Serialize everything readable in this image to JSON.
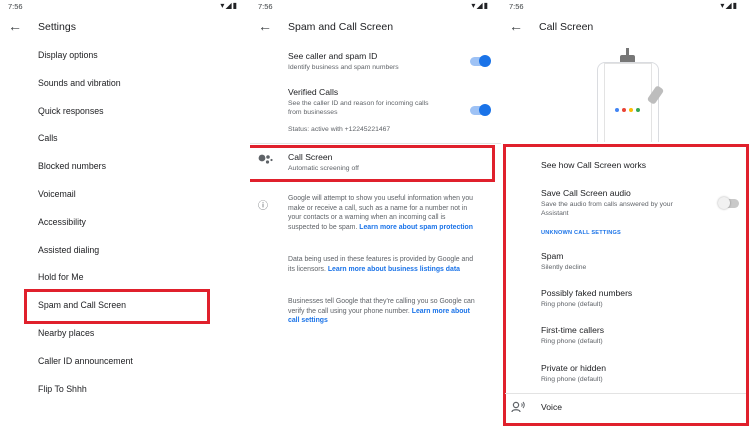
{
  "status": {
    "time": "7:56",
    "icons": "▾◢▮"
  },
  "settings": {
    "title": "Settings",
    "items": [
      "Display options",
      "Sounds and vibration",
      "Quick responses",
      "Calls",
      "Blocked numbers",
      "Voicemail",
      "Accessibility",
      "Assisted dialing",
      "Hold for Me",
      "Spam and Call Screen",
      "Nearby places",
      "Caller ID announcement",
      "Flip To Shhh"
    ]
  },
  "spam": {
    "title": "Spam and Call Screen",
    "caller_id": {
      "label": "See caller and spam ID",
      "sub": "Identify business and spam numbers",
      "on": true
    },
    "verified": {
      "label": "Verified Calls",
      "sub": "See the caller ID and reason for incoming calls from businesses",
      "on": true
    },
    "status_text": "Status: active with +12245221467",
    "call_screen": {
      "label": "Call Screen",
      "sub": "Automatic screening off"
    },
    "info1": {
      "text": "Google will attempt to show you useful information when you make or receive a call, such as a name for a number not in your contacts or a warning when an incoming call is suspected to be spam.",
      "link": "Learn more about spam protection"
    },
    "info2": {
      "text": "Data being used in these features is provided by Google and its licensors.",
      "link": "Learn more about business listings data"
    },
    "info3": {
      "text": "Businesses tell Google that they're calling you so Google can verify the call using your phone number.",
      "link": "Learn more about call settings"
    }
  },
  "callscreen": {
    "title": "Call Screen",
    "how_link": "See how Call Screen works",
    "save_audio": {
      "label": "Save Call Screen audio",
      "sub": "Save the audio from calls answered by your Assistant",
      "on": false
    },
    "section_header": "UNKNOWN CALL SETTINGS",
    "options": [
      {
        "label": "Spam",
        "value": "Silently decline"
      },
      {
        "label": "Possibly faked numbers",
        "value": "Ring phone (default)"
      },
      {
        "label": "First-time callers",
        "value": "Ring phone (default)"
      },
      {
        "label": "Private or hidden",
        "value": "Ring phone (default)"
      }
    ],
    "voice": "Voice"
  },
  "colors": {
    "highlight": "#e0202c",
    "toggle_on": "#1a73e8",
    "link": "#1a73e8"
  }
}
